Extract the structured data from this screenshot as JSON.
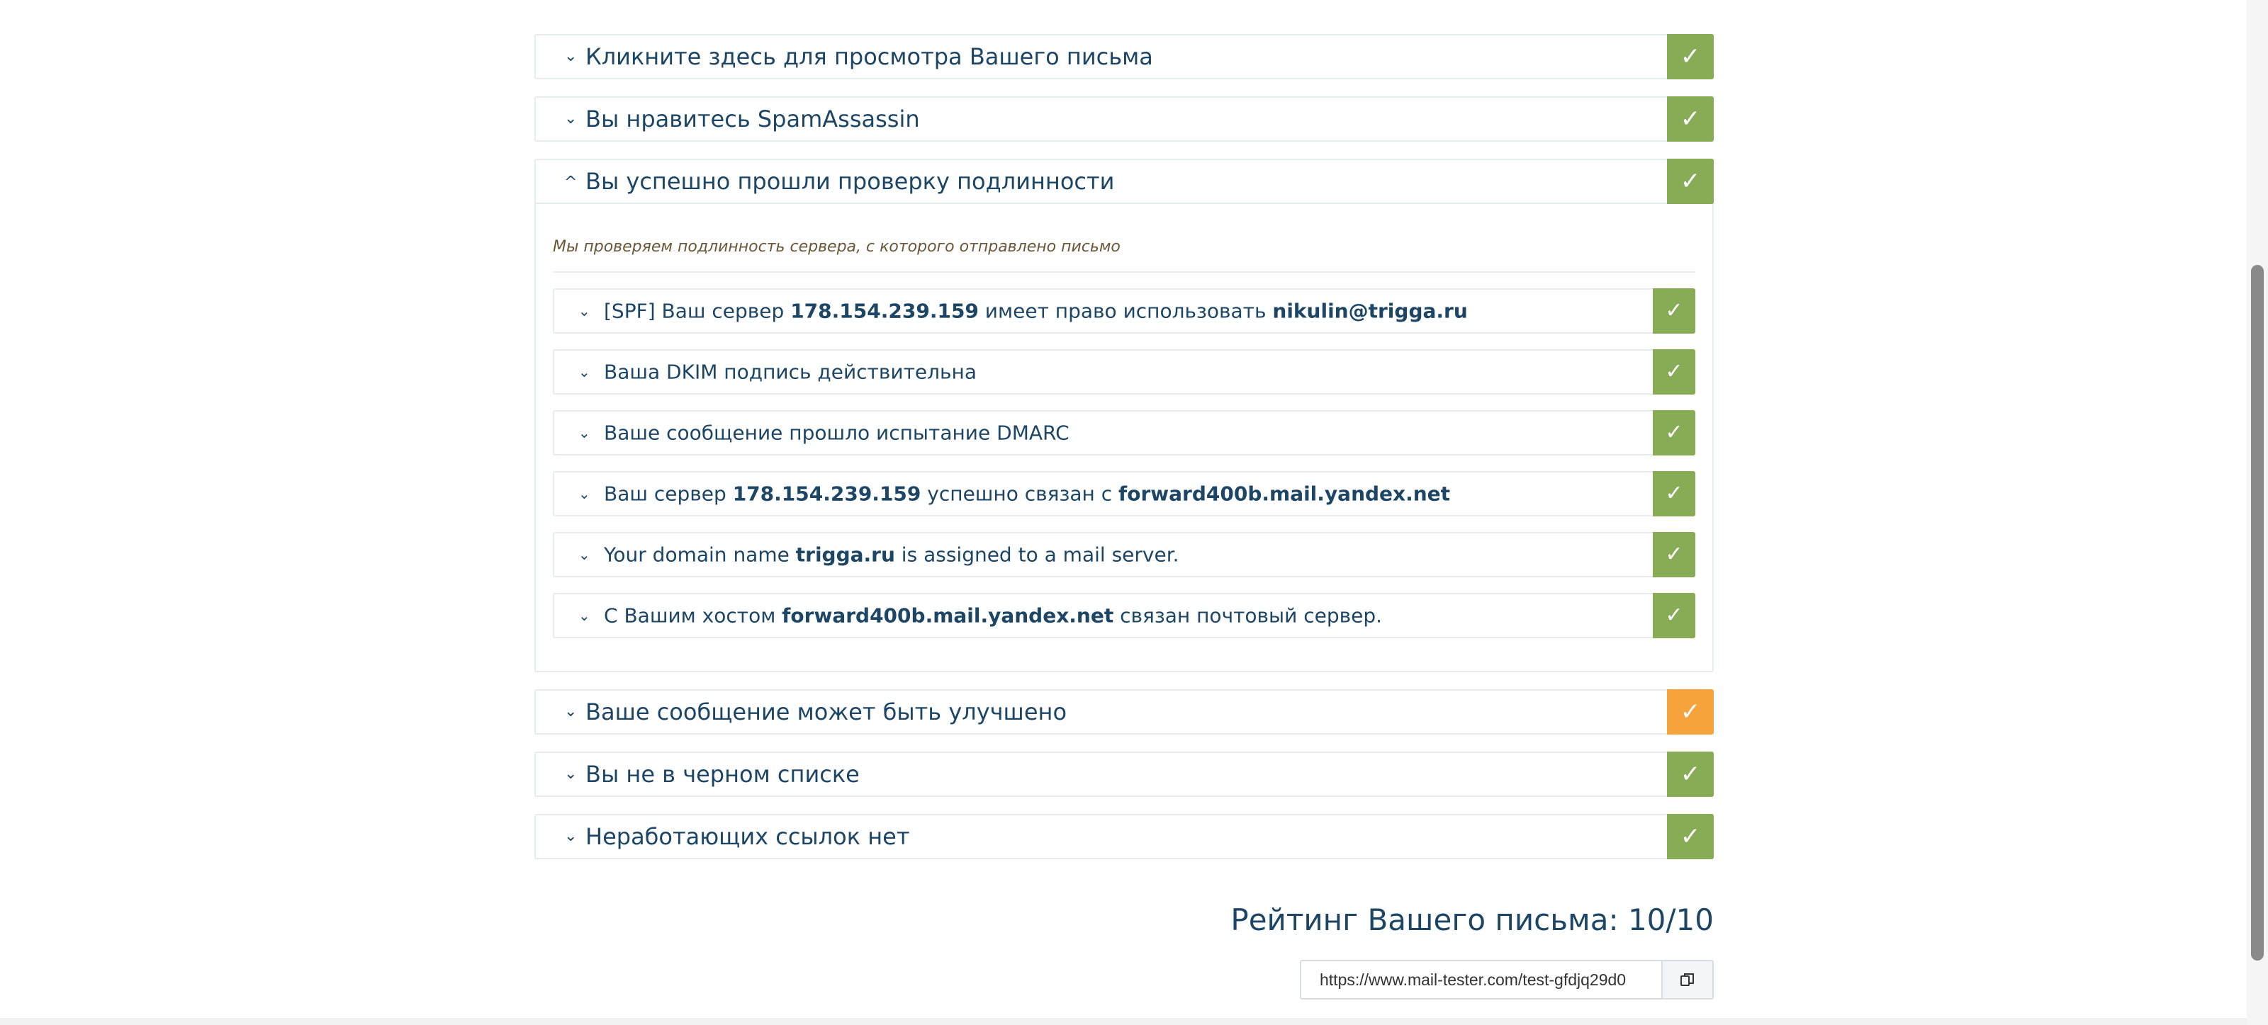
{
  "panels_top": [
    {
      "title": "Кликните здесь для просмотра Вашего письма",
      "status": "ok"
    },
    {
      "title": "Вы нравитесь SpamAssassin",
      "status": "ok"
    }
  ],
  "auth": {
    "title": "Вы успешно прошли проверку подлинности",
    "intro": "Мы проверяем подлинность сервера, с которого отправлено письмо",
    "items": [
      {
        "parts": [
          {
            "t": "[SPF] Ваш сервер "
          },
          {
            "t": "178.154.239.159",
            "b": true
          },
          {
            "t": " имеет право использовать "
          },
          {
            "t": "nikulin@trigga.ru",
            "b": true
          }
        ]
      },
      {
        "parts": [
          {
            "t": "Ваша DKIM подпись действительна"
          }
        ]
      },
      {
        "parts": [
          {
            "t": "Ваше сообщение прошло испытание DMARC"
          }
        ]
      },
      {
        "parts": [
          {
            "t": "Ваш сервер "
          },
          {
            "t": "178.154.239.159",
            "b": true
          },
          {
            "t": " успешно связан с "
          },
          {
            "t": "forward400b.mail.yandex.net",
            "b": true
          }
        ]
      },
      {
        "parts": [
          {
            "t": "Your domain name "
          },
          {
            "t": "trigga.ru",
            "b": true
          },
          {
            "t": " is assigned to a mail server."
          }
        ]
      },
      {
        "parts": [
          {
            "t": "С Вашим хостом "
          },
          {
            "t": "forward400b.mail.yandex.net",
            "b": true
          },
          {
            "t": " связан почтовый сервер."
          }
        ]
      }
    ]
  },
  "panels_bottom": [
    {
      "title": "Ваше сообщение может быть улучшено",
      "status": "warn"
    },
    {
      "title": "Вы не в черном списке",
      "status": "ok"
    },
    {
      "title": "Неработающих ссылок нет",
      "status": "ok"
    }
  ],
  "icons": {
    "check": "✓",
    "chevron_down": "⌄",
    "chevron_up": "^",
    "copy": "copy-icon"
  },
  "rating": "Рейтинг Вашего письма: 10/10",
  "share_url": "https://www.mail-tester.com/test-gfdjq29d0",
  "colors": {
    "ok": "#88ab56",
    "warn": "#f7a33c",
    "text": "#1c4566"
  }
}
